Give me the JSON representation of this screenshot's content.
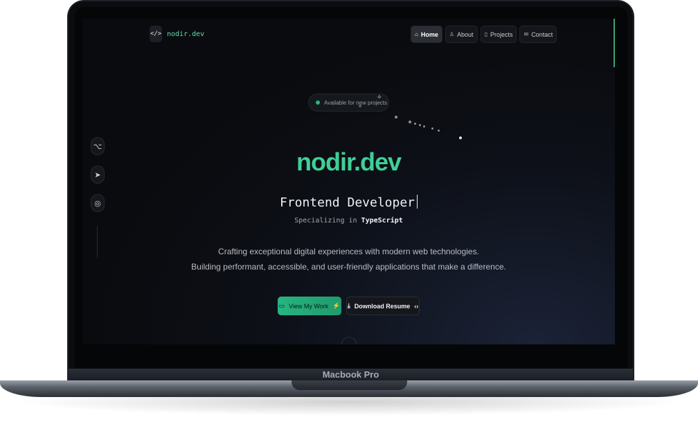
{
  "device": {
    "label": "Macbook Pro"
  },
  "nav": {
    "logo_icon": "</>",
    "logo_text": "nodir.dev",
    "items": [
      {
        "label": "Home",
        "icon": "⌂",
        "active": true
      },
      {
        "label": "About",
        "icon": "♙",
        "active": false
      },
      {
        "label": "Projects",
        "icon": "▯",
        "active": false
      },
      {
        "label": "Contact",
        "icon": "✉",
        "active": false
      }
    ]
  },
  "socials": [
    {
      "name": "github-icon",
      "glyph": "⌥"
    },
    {
      "name": "telegram-icon",
      "glyph": "➤"
    },
    {
      "name": "instagram-icon",
      "glyph": "◎"
    }
  ],
  "hero": {
    "badge": "Available for new projects",
    "sparkle": "✧",
    "title": "nodir.dev",
    "role": "Frontend Developer",
    "spec_prefix": "Specializing in ",
    "spec_highlight": "TypeScript",
    "desc_line1": "Crafting exceptional digital experiences with modern web technologies.",
    "desc_line2": "Building performant, accessible, and user-friendly applications that make a difference.",
    "primary_button": "View My Work",
    "primary_icon_left": "▭",
    "primary_icon_right": "⚡",
    "secondary_button": "Download Resume",
    "secondary_icon_left": "⤓",
    "secondary_icon_right": "‹›"
  },
  "colors": {
    "accent": "#3fcf97",
    "background": "#0a0b0e"
  }
}
